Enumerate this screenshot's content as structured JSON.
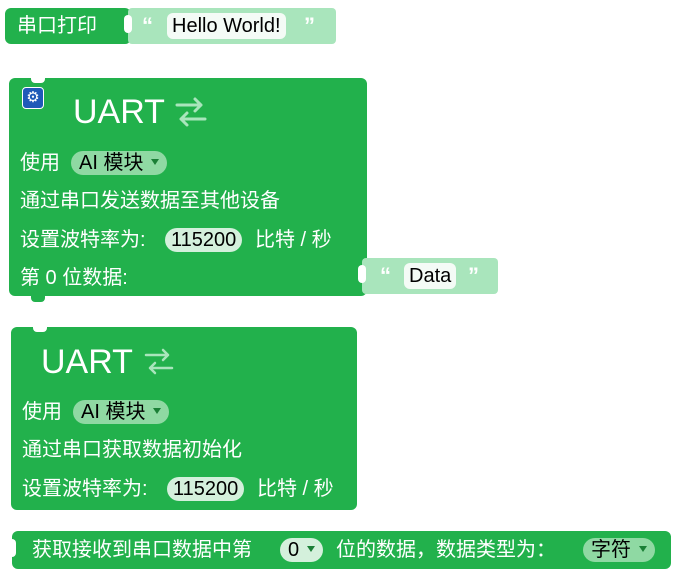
{
  "serial_print": {
    "label": "串口打印",
    "text_value": "Hello World!",
    "open_quote": "“",
    "close_quote": "”"
  },
  "uart_send": {
    "settings_icon": "gear-icon",
    "title": "UART",
    "title_icon": "swap-arrows-icon",
    "use_label": "使用",
    "module_value": "AI 模块",
    "desc": "通过串口发送数据至其他设备",
    "baud_label": "设置波特率为:",
    "baud_value": "115200",
    "baud_unit": "比特 / 秒",
    "data_label": "第 0 位数据:",
    "data_value": "Data",
    "open_quote": "“",
    "close_quote": "”"
  },
  "uart_receive": {
    "title": "UART",
    "title_icon": "swap-arrows-icon",
    "use_label": "使用",
    "module_value": "AI 模块",
    "desc": "通过串口获取数据初始化",
    "baud_label": "设置波特率为:",
    "baud_value": "115200",
    "baud_unit": "比特 / 秒"
  },
  "get_data": {
    "prefix": "获取接收到串口数据中第",
    "index_value": "0",
    "middle": "位的数据，数据类型为：",
    "type_value": "字符"
  },
  "colors": {
    "block_green": "#22b14c",
    "text_block": "#a9e5bc",
    "dropdown": "#8fd9a3"
  }
}
